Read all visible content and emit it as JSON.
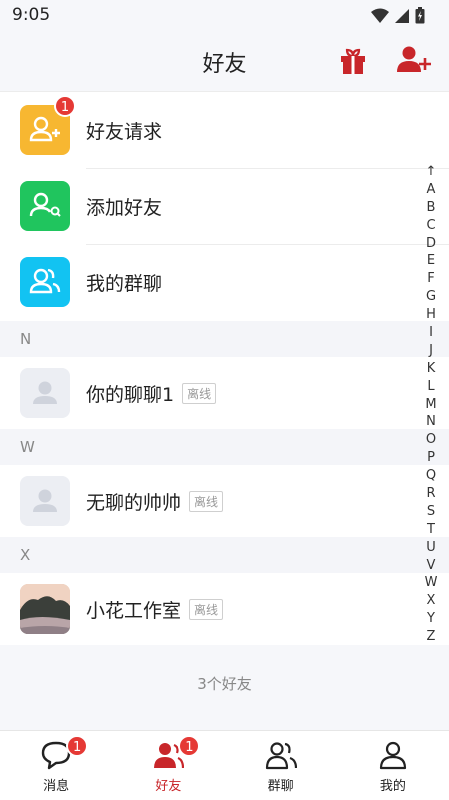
{
  "status_bar": {
    "time": "9:05"
  },
  "header": {
    "title": "好友"
  },
  "functions": [
    {
      "label": "好友请求",
      "badge": "1",
      "color": "#f7b731"
    },
    {
      "label": "添加好友",
      "color": "#20c55e"
    },
    {
      "label": "我的群聊",
      "color": "#12c3f2"
    }
  ],
  "sections": [
    {
      "letter": "N",
      "contacts": [
        {
          "name": "你的聊聊1",
          "status": "离线"
        }
      ]
    },
    {
      "letter": "W",
      "contacts": [
        {
          "name": "无聊的帅帅",
          "status": "离线"
        }
      ]
    },
    {
      "letter": "X",
      "contacts": [
        {
          "name": "小花工作室",
          "status": "离线"
        }
      ]
    }
  ],
  "index_letters": [
    "↑",
    "A",
    "B",
    "C",
    "D",
    "E",
    "F",
    "G",
    "H",
    "I",
    "J",
    "K",
    "L",
    "M",
    "N",
    "O",
    "P",
    "Q",
    "R",
    "S",
    "T",
    "U",
    "V",
    "W",
    "X",
    "Y",
    "Z",
    "#"
  ],
  "footer": {
    "friend_count": "3个好友"
  },
  "tabs": [
    {
      "label": "消息",
      "badge": "1",
      "icon": "chat-bubble-icon"
    },
    {
      "label": "好友",
      "badge": "1",
      "icon": "friends-icon",
      "active": true
    },
    {
      "label": "群聊",
      "icon": "group-icon"
    },
    {
      "label": "我的",
      "icon": "profile-icon"
    }
  ],
  "colors": {
    "accent": "#c8262a",
    "badge": "#e53935"
  }
}
